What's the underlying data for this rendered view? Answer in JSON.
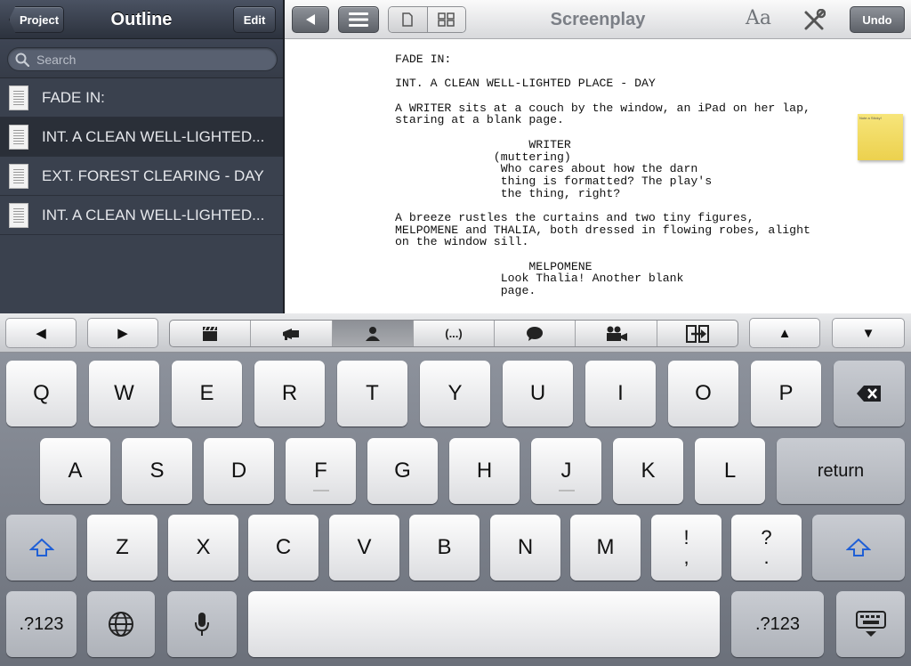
{
  "sidebar": {
    "title": "Outline",
    "project_label": "Project",
    "edit_label": "Edit",
    "search_placeholder": "Search",
    "items": [
      {
        "label": "FADE IN:"
      },
      {
        "label": "INT. A CLEAN WELL-LIGHTED..."
      },
      {
        "label": "EXT. FOREST CLEARING - DAY"
      },
      {
        "label": "INT. A CLEAN WELL-LIGHTED..."
      }
    ]
  },
  "editor": {
    "title": "Screenplay",
    "font_label": "Aa",
    "undo_label": "Undo",
    "sticky_text": "Note a Sticky!",
    "lines": [
      "FADE IN:",
      "",
      "INT. A CLEAN WELL-LIGHTED PLACE - DAY",
      "",
      "A WRITER sits at a couch by the window, an iPad on her lap,",
      "staring at a blank page.",
      "",
      "                   WRITER",
      "              (muttering)",
      "               Who cares about how the darn",
      "               thing is formatted? The play's",
      "               the thing, right?",
      "",
      "A breeze rustles the curtains and two tiny figures,",
      "MELPOMENE and THALIA, both dressed in flowing robes, alight",
      "on the window sill.",
      "",
      "                   MELPOMENE",
      "               Look Thalia! Another blank",
      "               page."
    ]
  },
  "accessory": {
    "left_arrow": "◀",
    "right_arrow": "▶",
    "up_arrow": "▲",
    "down_arrow": "▼",
    "segments": [
      {
        "icon": "scene-heading-icon"
      },
      {
        "icon": "action-icon"
      },
      {
        "icon": "character-icon"
      },
      {
        "icon": "parenthetical-icon",
        "label": "(...)"
      },
      {
        "icon": "dialogue-icon"
      },
      {
        "icon": "transition-icon"
      },
      {
        "icon": "shot-icon"
      }
    ]
  },
  "keyboard": {
    "row1": [
      "Q",
      "W",
      "E",
      "R",
      "T",
      "Y",
      "U",
      "I",
      "O",
      "P"
    ],
    "row2": [
      "A",
      "S",
      "D",
      "F",
      "G",
      "H",
      "J",
      "K",
      "L"
    ],
    "row3": [
      "Z",
      "X",
      "C",
      "V",
      "B",
      "N",
      "M"
    ],
    "return_label": "return",
    "numbers_label": ".?123",
    "punct1_top": "!",
    "punct1_bottom": ",",
    "punct2_top": "?",
    "punct2_bottom": "."
  },
  "colors": {
    "sidebar_bg": "#3a414e",
    "shift_blue": "#1f5fd6"
  }
}
